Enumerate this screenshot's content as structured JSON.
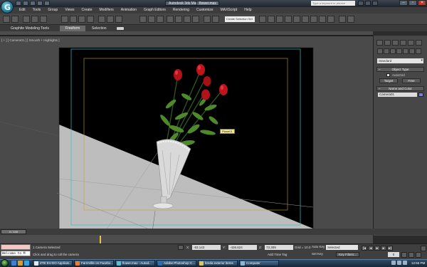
{
  "window": {
    "title": "Autodesk 3ds Max 2010",
    "file": "flower.max",
    "search_placeholder": "Type a keyword or phrase",
    "controls": [
      "–",
      "▫",
      "✕"
    ]
  },
  "menu": [
    "Edit",
    "Tools",
    "Group",
    "Views",
    "Create",
    "Modifiers",
    "Animation",
    "Graph Editors",
    "Rendering",
    "Customize",
    "MAXScript",
    "Help"
  ],
  "toolbar": {
    "selection_set": "Create Selection Set"
  },
  "ribbon": {
    "tabs": [
      "Graphite Modeling Tools",
      "Freeform",
      "Selection"
    ],
    "active_tab": "Freeform"
  },
  "viewport": {
    "label": "[ + ] [ Camera01 ] [ Smooth + Highlights ]",
    "camera_tag": "Plane01"
  },
  "command_panel": {
    "dropdown": "Standard",
    "object_type_title": "Object Type",
    "autogrid": "AutoGrid",
    "btn_target": "Target",
    "btn_free": "Free",
    "name_color_title": "Name and Color",
    "object_name": "Camera01",
    "object_color": "#6e86e6"
  },
  "timeline": {
    "slider": "0 / 100"
  },
  "status": {
    "maxscript_input": "Welcome to M",
    "selection": "1 Camera Selected",
    "prompt": "Click and drag to roll the camera",
    "x_label": "X:",
    "x_value": "-83.143",
    "y_label": "Y:",
    "y_value": "-426.624",
    "z_label": "Z:",
    "z_value": "73.309",
    "grid": "Grid = 10.0",
    "add_time_tag": "Add Time Tag",
    "auto_key": "Auto Key",
    "set_key": "Set Key",
    "key_mode": "Selected",
    "key_filters": "Key Filters...",
    "frame": "0"
  },
  "taskbar": {
    "tasks": [
      "ZTE EV-DO Applicat...",
      "FarmVille on Facebo...",
      "flower.max - Autod...",
      "Adobe Photoshop C...",
      "breda exterior items",
      "Computer"
    ],
    "clock": "12:55 PM"
  }
}
